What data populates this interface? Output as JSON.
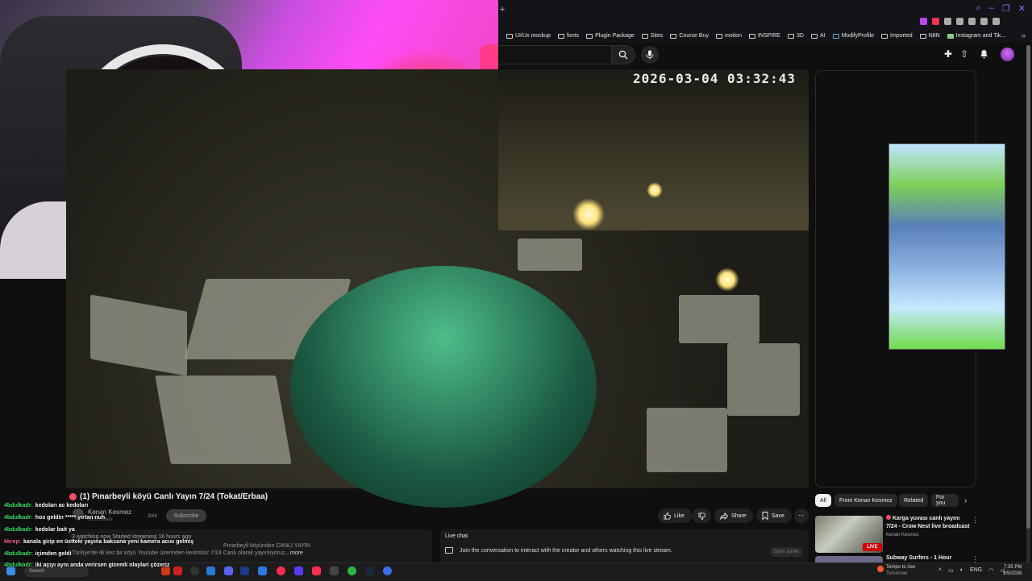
{
  "browser": {
    "new_tab_symbol": "+",
    "bookmarks": [
      "UI/Ux mockup",
      "fonts",
      "Plugin Package",
      "Sites",
      "Course Buy",
      "motion",
      "INSPIRE",
      "3D",
      "AI",
      "ModifyProfile",
      "Imported",
      "N8N",
      "Instagram and Tik..."
    ],
    "bookmarks_chevron": "»"
  },
  "video": {
    "timestamp": "2026-03-04 03:32:43",
    "title": "(1) Pınarbeyli köyü Canlı Yayın 7/24 (Tokat/Erbaa)",
    "channel_name": "Kenan Kesmez",
    "subscribers": "subscribers",
    "join_label": "Join",
    "subscribe_label": "Subscribe",
    "actions": {
      "like": "Like",
      "share": "Share",
      "save": "Save",
      "more": "⋯"
    },
    "description": {
      "line1": "3 watching now  Started streaming 16 hours ago",
      "line2": "Türkiye'de ilk kez bir köyü Youtube üzerinden kesintisiz 7/24 Canlı olarak yayınlıyoruz.",
      "line2b": "Pınarbeyli köyünden CANLI YAYIN",
      "more": "...more"
    }
  },
  "live_chat": {
    "title": "Live chat",
    "prompt": "Join the conversation to interact with the creator and others watching this live stream.",
    "open_panel": "Open panel"
  },
  "sidebar": {
    "chips": [
      "All",
      "From Kenan Kesmez",
      "Related",
      "For you"
    ],
    "related": [
      {
        "title": "Karga yuvası canlı yayını 7/24 - Crow Nest live broadcast",
        "channel": "Kenan Kesmez",
        "badge": "LIVE"
      },
      {
        "title": "Subway Surfers - 1 Hour"
      }
    ]
  },
  "stream_chat": [
    {
      "user": "4bdulkadr:",
      "msg": "kedoları ac kedoları",
      "color": "#3ae06a"
    },
    {
      "user": "4bdulkadr:",
      "msg": "hos geldin ***** yırtan nuh",
      "color": "#3ae06a"
    },
    {
      "user": "4bdulkadr:",
      "msg": "kedolar bait ya",
      "color": "#3ae06a"
    },
    {
      "user": "kkrep:",
      "msg": "kanala girip en üstteki yayına baksana yeni kamera acısı gelmiş",
      "color": "#ff5fa0"
    },
    {
      "user": "4bdulkadr:",
      "msg": "içimden geldi",
      "color": "#3ae06a"
    },
    {
      "user": "4bdulkadr:",
      "msg": "iki açıyı aynı anda verirsen gizemli olaylari çözeriz",
      "color": "#3ae06a"
    }
  ],
  "taskbar": {
    "search_placeholder": "Search",
    "weather_title": "Tempo to rise",
    "weather_sub": "Tomorrow",
    "lang": "ENG",
    "time": "7:35 PM",
    "date": "3/5/2026"
  },
  "colors": {
    "accent": "#ff0000",
    "live": "#cc0000",
    "chat_green": "#3ae06a",
    "chat_pink": "#ff5fa0"
  }
}
